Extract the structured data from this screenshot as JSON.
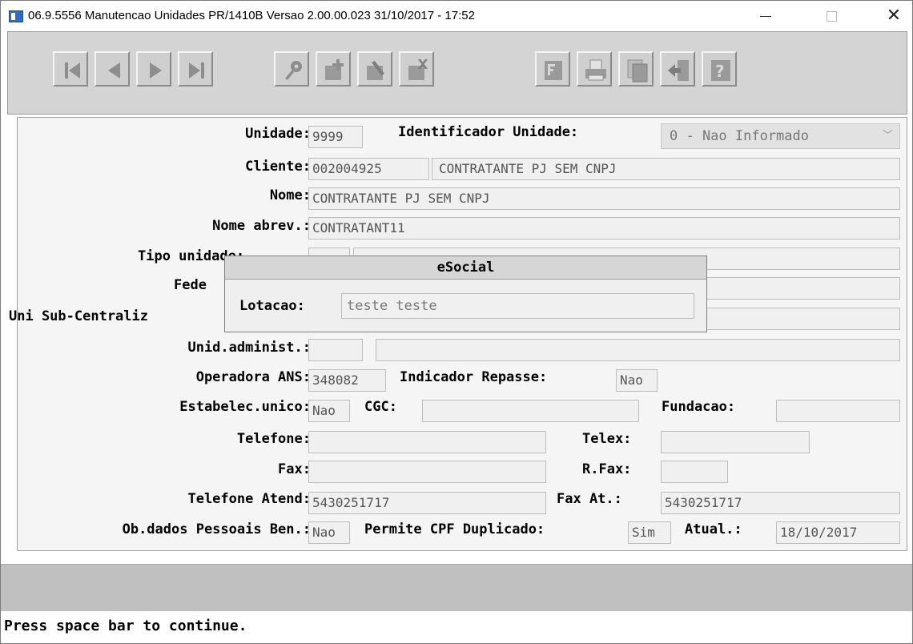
{
  "window": {
    "title": "06.9.5556 Manutencao  Unidades PR/1410B Versao 2.00.00.023 31/10/2017 - 17:52",
    "controls": {
      "minimize": "—",
      "maximize": "□",
      "close": "✕"
    }
  },
  "toolbar": {
    "buttons": [
      {
        "name": "first-record",
        "icon": "first-icon"
      },
      {
        "name": "previous-record",
        "icon": "prev-icon"
      },
      {
        "name": "next-record",
        "icon": "next-icon"
      },
      {
        "name": "last-record",
        "icon": "last-icon"
      },
      {
        "name": "goto",
        "icon": "key-icon"
      },
      {
        "name": "add",
        "icon": "add-icon"
      },
      {
        "name": "modify",
        "icon": "edit-icon"
      },
      {
        "name": "delete",
        "icon": "delete-icon"
      },
      {
        "name": "filter",
        "icon": "filter-icon"
      },
      {
        "name": "print",
        "icon": "print-icon"
      },
      {
        "name": "copy",
        "icon": "copy-icon"
      },
      {
        "name": "exit",
        "icon": "exit-icon"
      },
      {
        "name": "help",
        "icon": "help-icon"
      }
    ]
  },
  "form": {
    "unidade": {
      "label": "Unidade:",
      "value": "9999"
    },
    "identificador": {
      "label": "Identificador Unidade:",
      "value": "0 - Nao Informado"
    },
    "cliente": {
      "label": "Cliente:",
      "code": "002004925",
      "name": "CONTRATANTE PJ SEM CNPJ"
    },
    "nome": {
      "label": "Nome:",
      "value": "CONTRATANTE PJ SEM CNPJ"
    },
    "nome_abrev": {
      "label": "Nome abrev.:",
      "value": "CONTRATANT11"
    },
    "tipo_unidade": {
      "label": "Tipo un",
      "hidden_tail": "idade:"
    },
    "federacao": {
      "label": "Fede"
    },
    "uni_sub": {
      "label": "Uni Sub-Centraliz"
    },
    "unid_admin": {
      "label": "Unid.administ.:"
    },
    "operadora": {
      "label": "Operadora ANS:",
      "value": "348082"
    },
    "indicador_repasse": {
      "label": "Indicador Repasse:",
      "value": "Nao"
    },
    "estabelec": {
      "label": "Estabelec.unico:",
      "value": "Nao"
    },
    "cgc": {
      "label": "CGC:"
    },
    "fundacao": {
      "label": "Fundacao:"
    },
    "telefone": {
      "label": "Telefone:"
    },
    "telex": {
      "label": "Telex:"
    },
    "fax": {
      "label": "Fax:"
    },
    "rfax": {
      "label": "R.Fax:"
    },
    "telefone_atend": {
      "label": "Telefone Atend:",
      "value": "5430251717"
    },
    "fax_at": {
      "label": "Fax At.:",
      "value": "5430251717"
    },
    "ob_dados": {
      "label": "Ob.dados Pessoais Ben.:",
      "value": "Nao"
    },
    "permite_cpf": {
      "label": "Permite CPF Duplicado:",
      "value": "Sim"
    },
    "atual": {
      "label": "Atual.:",
      "value": "18/10/2017"
    }
  },
  "dialog": {
    "title": "eSocial",
    "lotacao_label": "Lotacao:",
    "lotacao_value": "teste teste"
  },
  "status": {
    "message": "Press space bar to continue."
  }
}
